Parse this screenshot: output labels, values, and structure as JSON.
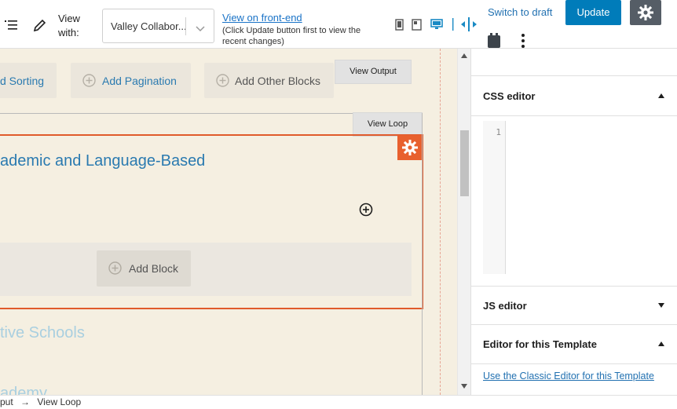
{
  "toolbar": {
    "view_with_label": "View with:",
    "template_select_value": "Valley Collabor...",
    "frontend_link": "View on front-end",
    "frontend_note": "(Click Update button first to view the recent changes)",
    "switch_to_draft": "Switch to draft",
    "update_label": "Update"
  },
  "canvas": {
    "chips": {
      "sorting": "d Sorting",
      "pagination": "Add Pagination",
      "other_blocks": "Add Other Blocks"
    },
    "view_output": "View Output",
    "view_loop": "View Loop",
    "heading_1": "ademic and Language-Based",
    "add_block": "Add Block",
    "heading_2": "tive Schools",
    "heading_3": "ademy"
  },
  "sidebar": {
    "css_editor": "CSS editor",
    "line_number": "1",
    "js_editor": "JS editor",
    "template_editor": "Editor for this Template",
    "classic_editor_link": "Use the Classic Editor for this Template"
  },
  "breadcrumb": {
    "part_1": "put",
    "arrow": "→",
    "part_2": "View Loop"
  },
  "colors": {
    "accent_blue": "#007cba",
    "link_blue": "#2271b1",
    "loop_orange": "#e8602e",
    "canvas_bg": "#f5efe1"
  }
}
